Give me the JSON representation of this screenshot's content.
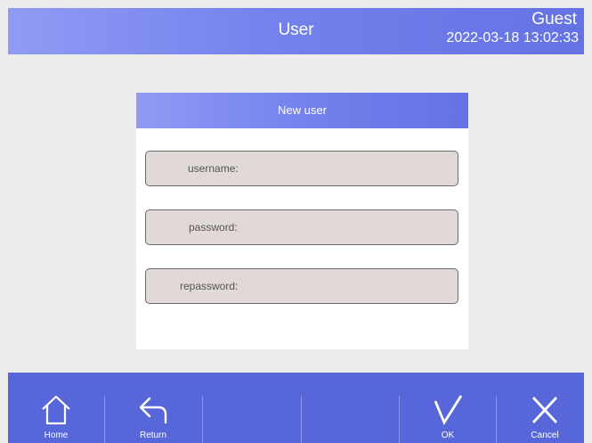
{
  "header": {
    "title": "User",
    "user": "Guest",
    "datetime": "2022-03-18 13:02:33"
  },
  "dialog": {
    "title": "New user",
    "fields": [
      {
        "label": "username:",
        "value": ""
      },
      {
        "label": "password:",
        "value": ""
      },
      {
        "label": "repassword:",
        "value": ""
      }
    ]
  },
  "footer": {
    "buttons": [
      {
        "label": "Home",
        "icon": "home-icon"
      },
      {
        "label": "Return",
        "icon": "return-arrow-icon"
      },
      {
        "label": "",
        "icon": ""
      },
      {
        "label": "",
        "icon": ""
      },
      {
        "label": "OK",
        "icon": "check-icon"
      },
      {
        "label": "Cancel",
        "icon": "close-icon"
      }
    ]
  },
  "colors": {
    "header_gradient_start": "#8f9bf3",
    "header_gradient_end": "#6472e3",
    "footer_bg": "#5767d9",
    "field_bg": "#e1d8d8",
    "page_bg": "#ececec"
  }
}
